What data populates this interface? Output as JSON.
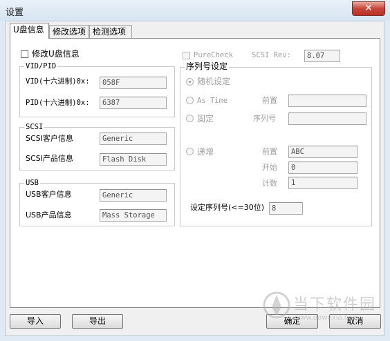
{
  "window": {
    "title": "设置",
    "close_glyph": "✕"
  },
  "tabs": [
    {
      "label": "U盘信息",
      "active": true
    },
    {
      "label": "修改选项",
      "active": false
    },
    {
      "label": "检测选项",
      "active": false
    }
  ],
  "modify_usb_info": {
    "label": "修改U盘信息",
    "checked": false
  },
  "vidpid": {
    "group_label": "VID/PID",
    "vid_label": "VID(十六进制)0x:",
    "vid_value": "058F",
    "pid_label": "PID(十六进制)0x:",
    "pid_value": "6387"
  },
  "scsi": {
    "group_label": "SCSI",
    "vendor_label": "SCSI客户信息",
    "vendor_value": "Generic",
    "product_label": "SCSI产品信息",
    "product_value": "Flash Disk"
  },
  "usb": {
    "group_label": "USB",
    "vendor_label": "USB客户信息",
    "vendor_value": "Generic",
    "product_label": "USB产品信息",
    "product_value": "Mass Storage"
  },
  "purecheck": {
    "label": "PureCheck",
    "checked": false
  },
  "scsi_rev": {
    "label": "SCSI Rev:",
    "value": "8.07"
  },
  "serial": {
    "group_label": "序列号设定",
    "random_label": "随机设定",
    "astime_label": "As Time",
    "astime_prefix_label": "前置",
    "astime_prefix_value": "",
    "fixed_label": "固定",
    "fixed_serial_label": "序列号",
    "fixed_serial_value": "",
    "increment_label": "递增",
    "inc_prefix_label": "前置",
    "inc_prefix_value": "ABC",
    "inc_start_label": "开始",
    "inc_start_value": "0",
    "inc_count_label": "计数",
    "inc_count_value": "1",
    "length_label": "设定序列号(<=30位)",
    "length_value": "8"
  },
  "buttons": {
    "import": "导入",
    "export": "导出",
    "ok": "确定",
    "cancel": "取消"
  },
  "watermark": {
    "text": "当下软件园",
    "url": "www.downxia.com"
  }
}
